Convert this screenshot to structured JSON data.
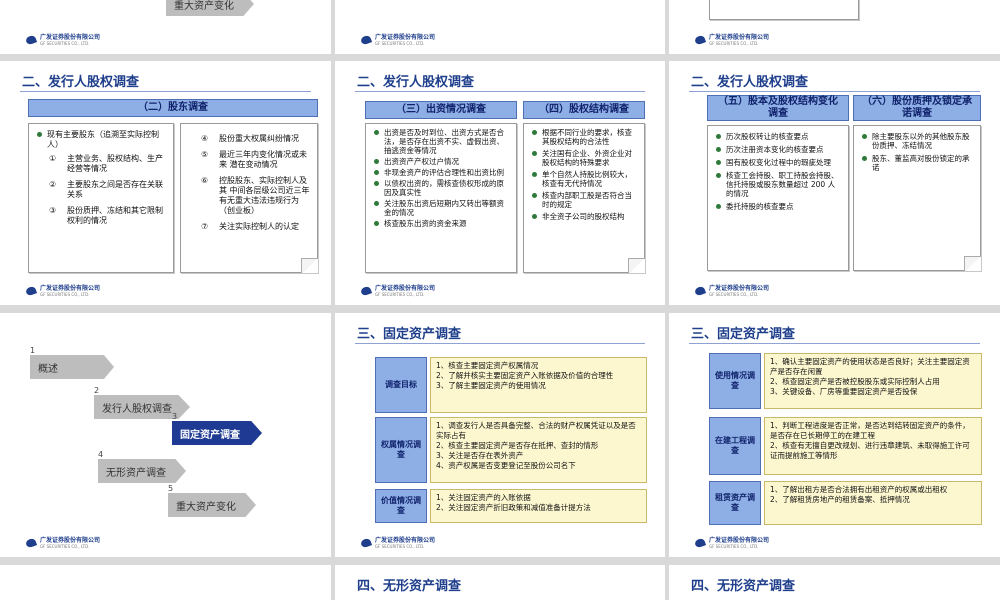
{
  "logo": {
    "text": "广发证券股份有限公司",
    "sub": "GF SECURITIES CO., LTD."
  },
  "row1": {
    "slide_a_fragment": "重大资产变化"
  },
  "slide_shareholders": {
    "title": "二、发行人股权调查",
    "header": "（二）股东调查",
    "left_bullet": "现有主要股东（追溯至实际控制人）",
    "left_items": [
      {
        "n": "①",
        "t": "主营业务、股权结构、生产经营等情况"
      },
      {
        "n": "②",
        "t": "主要股东之间是否存在关联关系"
      },
      {
        "n": "③",
        "t": "股份质押、冻结和其它限制权利的情况"
      }
    ],
    "right_items": [
      {
        "n": "④",
        "t": "股份重大权属纠纷情况"
      },
      {
        "n": "⑤",
        "t": "最近三年内变化情况或未来  潜在变动情况"
      },
      {
        "n": "⑥",
        "t": "控股股东、实际控制人及其  中间各层级公司近三年有无重大违法违规行为（创业板）"
      },
      {
        "n": "⑦",
        "t": "关注实际控制人的认定"
      }
    ]
  },
  "slide_capital": {
    "title": "二、发行人股权调查",
    "header_left": "（三）出资情况调查",
    "header_right": "（四）股权结构调查",
    "left_items": [
      "出资是否及时到位、出资方式是否合法，是否存在出资不实、虚假出资、抽逃资金等情况",
      "出资资产产权过户情况",
      "非现金资产的评估合理性和出资比例",
      "以债权出资的，需核查债权形成的原因及真实性",
      "关注股东出资后短期内又转出等额资金的情况",
      "核查股东出资的资金来源"
    ],
    "right_items": [
      "根据不同行业的要求，核查其股权结构的合法性",
      "关注国有企业、外资企业对股权结构的特殊要求",
      "单个自然人持股比例较大，核查有无代持情况",
      "核查内部职工股是否符合当时的规定",
      "非全资子公司的股权结构"
    ]
  },
  "slide_equity": {
    "title": "二、发行人股权调查",
    "header_left": "（五）股本及股权结构变化调查",
    "header_right": "（六）股份质押及锁定承诺调查",
    "left_items": [
      "历次股权转让的核查要点",
      "历次注册资本变化的核查要点",
      "国有股权变化过程中的瑕疵处理",
      "核查工会持股、职工持股会持股、信托持股或股东数量超过 200 人的情况",
      "委托持股的核查要点"
    ],
    "right_items": [
      "除主要股东以外的其他股东股份质押、冻结情况",
      "股东、董监高对股份锁定的承诺"
    ]
  },
  "slide_agenda": {
    "steps": [
      {
        "num": "1",
        "label": "概述"
      },
      {
        "num": "2",
        "label": "发行人股权调查"
      },
      {
        "num": "3",
        "label": "固定资产调查"
      },
      {
        "num": "4",
        "label": "无形资产调查"
      },
      {
        "num": "5",
        "label": "重大资产变化"
      }
    ]
  },
  "slide_fixed1": {
    "title": "三、固定资产调查",
    "rows": [
      {
        "label": "调查目标",
        "lines": [
          "1、核查主要固定资产权属情况",
          "2、了解并核实主要固定资产入账依据及价值的合理性",
          "3、了解主要固定资产的使用情况"
        ]
      },
      {
        "label": "权属情况调查",
        "lines": [
          "1、调查发行人是否具备完整、合法的财产权属凭证以及是否实际占有",
          "2、核查主要固定资产是否存在抵押、查封的情形",
          "3、关注是否存在表外资产",
          "4、资产权属是否变更登记至股份公司名下"
        ]
      },
      {
        "label": "价值情况调查",
        "lines": [
          "1、关注固定资产的入账依据",
          "2、关注固定资产折旧政策和减值准备计提方法"
        ]
      }
    ]
  },
  "slide_fixed2": {
    "title": "三、固定资产调查",
    "rows": [
      {
        "label": "使用情况调查",
        "lines": [
          "1、确认主要固定资产的使用状态是否良好；关注主要固定资产是否存在闲置",
          "2、核查固定资产是否被控股股东或实际控制人占用",
          "3、关键设备、厂房等重要固定资产是否投保"
        ]
      },
      {
        "label": "在建工程调查",
        "lines": [
          "1、判断工程进度是否正常，是否达到结转固定资产的条件，是否存在已长期停工的在建工程",
          "2、核查有无擅自更改规划、进行违章建筑、未取得施工许可证而提前施工等情形"
        ]
      },
      {
        "label": "租赁资产调查",
        "lines": [
          "1、了解出租方是否合法拥有出租资产的权属或出租权",
          "2、了解租赁房地产的租赁备案、抵押情况"
        ]
      }
    ]
  },
  "row4": {
    "title_mid": "四、无形资产调查",
    "title_right": "四、无形资产调查"
  }
}
